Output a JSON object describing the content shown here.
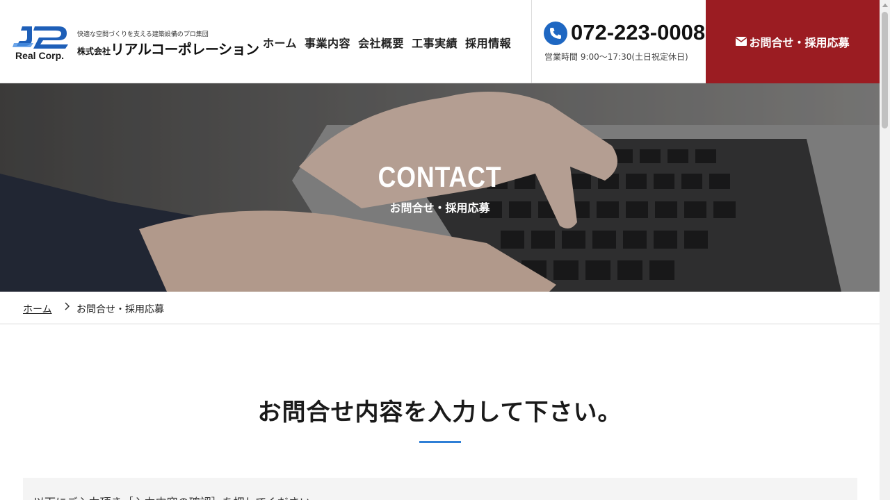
{
  "header": {
    "logo_mark_text": "Real Corp.",
    "tagline": "快適な空間づくりを支える建築設備のプロ集団",
    "company_prefix": "株式会社",
    "company_name": "リアルコーポレーション",
    "nav": [
      {
        "label": "ホーム"
      },
      {
        "label": "事業内容"
      },
      {
        "label": "会社概要"
      },
      {
        "label": "工事実績"
      },
      {
        "label": "採用情報"
      }
    ],
    "phone_number": "072-223-0008",
    "business_hours": "営業時間 9:00〜17:30(土日祝定休日)",
    "contact_button": "お問合せ・採用応募",
    "colors": {
      "brand_blue": "#1e67c2",
      "contact_red": "#9b1c22"
    }
  },
  "hero": {
    "title": "CONTACT",
    "subtitle": "お問合せ・採用応募"
  },
  "breadcrumb": {
    "home": "ホーム",
    "current": "お問合せ・採用応募"
  },
  "main": {
    "heading": "お問合せ内容を入力して下さい。",
    "intro": "以下にご入力頂き［入力内容の確認］を押してください。"
  }
}
